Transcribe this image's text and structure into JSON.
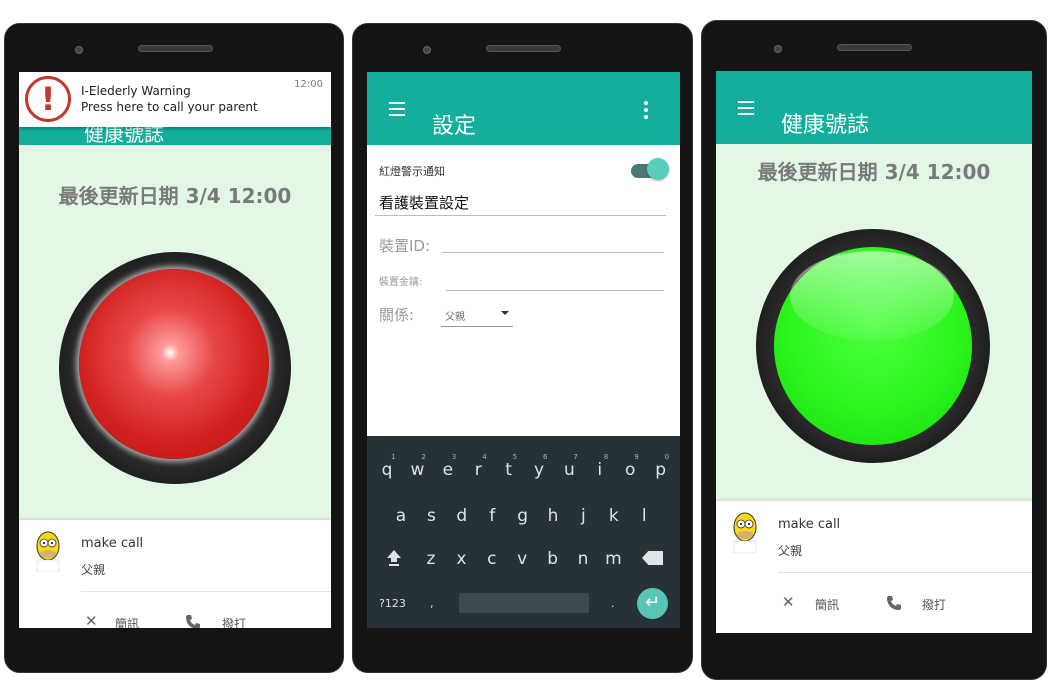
{
  "phone1": {
    "notification": {
      "title": "I-Elederly Warning",
      "text": "Press here to call your parent",
      "time": "12:00"
    },
    "behind_title": "健康號誌",
    "update_date": "最後更新日期 3/4 12:00",
    "light_status": "red",
    "call_card": {
      "name": "make call",
      "relation": "父親",
      "dismiss_label": "簡訊",
      "call_label": "撥打"
    }
  },
  "phone2": {
    "title": "設定",
    "switch_label": "紅燈警示通知",
    "switch_on": true,
    "section_title": "看護裝置設定",
    "device_id_label": "裝置ID:",
    "device_key_label": "裝置金鑰:",
    "relation_label": "關係:",
    "relation_value": "父親",
    "keyboard": {
      "row1": [
        "q",
        "w",
        "e",
        "r",
        "t",
        "y",
        "u",
        "i",
        "o",
        "p"
      ],
      "row1_hints": [
        "1",
        "2",
        "3",
        "4",
        "5",
        "6",
        "7",
        "8",
        "9",
        "0"
      ],
      "row2": [
        "a",
        "s",
        "d",
        "f",
        "g",
        "h",
        "j",
        "k",
        "l"
      ],
      "row3": [
        "z",
        "x",
        "c",
        "v",
        "b",
        "n",
        "m"
      ],
      "symbols_key": "?123",
      "comma_key": ",",
      "period_key": "."
    }
  },
  "phone3": {
    "title": "健康號誌",
    "update_date": "最後更新日期 3/4 12:00",
    "light_status": "green",
    "call_card": {
      "name": "make call",
      "relation": "父親",
      "dismiss_label": "簡訊",
      "call_label": "撥打"
    }
  },
  "colors": {
    "teal_appbar": "#13ae9c",
    "mint_background": "#e3f8e4",
    "keyboard_bg": "#263238",
    "red_light": "#d42222",
    "green_light": "#2cf51d",
    "warning_red": "#c0392b"
  },
  "icons": [
    "warning-icon",
    "menu-icon",
    "more-vert-icon",
    "close-icon",
    "phone-icon",
    "avatar-icon",
    "shift-icon",
    "backspace-icon",
    "enter-icon"
  ]
}
